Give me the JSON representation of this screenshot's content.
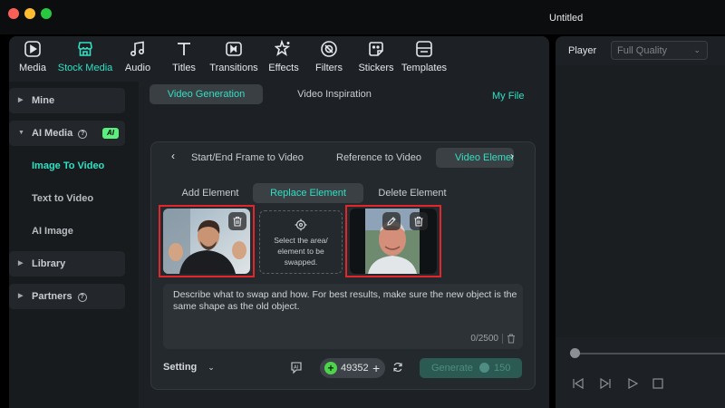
{
  "window": {
    "title": "Untitled"
  },
  "toolbar": {
    "items": [
      {
        "label": "Media",
        "icon": "media-icon"
      },
      {
        "label": "Stock Media",
        "icon": "stock-media-icon",
        "active": true
      },
      {
        "label": "Audio",
        "icon": "music-note-icon"
      },
      {
        "label": "Titles",
        "icon": "titles-t-icon"
      },
      {
        "label": "Transitions",
        "icon": "transitions-icon"
      },
      {
        "label": "Effects",
        "icon": "effects-icon"
      },
      {
        "label": "Filters",
        "icon": "filters-icon"
      },
      {
        "label": "Stickers",
        "icon": "stickers-icon"
      },
      {
        "label": "Templates",
        "icon": "templates-icon"
      }
    ]
  },
  "sidebar": {
    "mine": "Mine",
    "ai_media": "AI Media",
    "ai_badge": "AI",
    "sub_items": [
      "Image To Video",
      "Text to Video",
      "AI Image"
    ],
    "library": "Library",
    "partners": "Partners",
    "help_glyph": "?"
  },
  "content": {
    "tabs": [
      "Video Generation",
      "Video Inspiration"
    ],
    "my_file": "My File",
    "subtabs": [
      "Start/End Frame to Video",
      "Reference to Video",
      "Video Element"
    ],
    "element_options": [
      "Add Element",
      "Replace Element",
      "Delete Element"
    ],
    "select_area_text": "Select the area/ element to be swapped.",
    "prompt": {
      "text": "Describe what to swap and how. For best results, make sure the new object is the same shape as the old object.",
      "count": "0/2500"
    },
    "setting_label": "Setting",
    "credits": "49352",
    "generate_label": "Generate",
    "generate_cost": "150"
  },
  "player": {
    "label": "Player",
    "quality": "Full Quality"
  },
  "colors": {
    "accent": "#2fe0c3",
    "highlight_red": "#e2262b",
    "credit_green": "#4ed44a"
  }
}
